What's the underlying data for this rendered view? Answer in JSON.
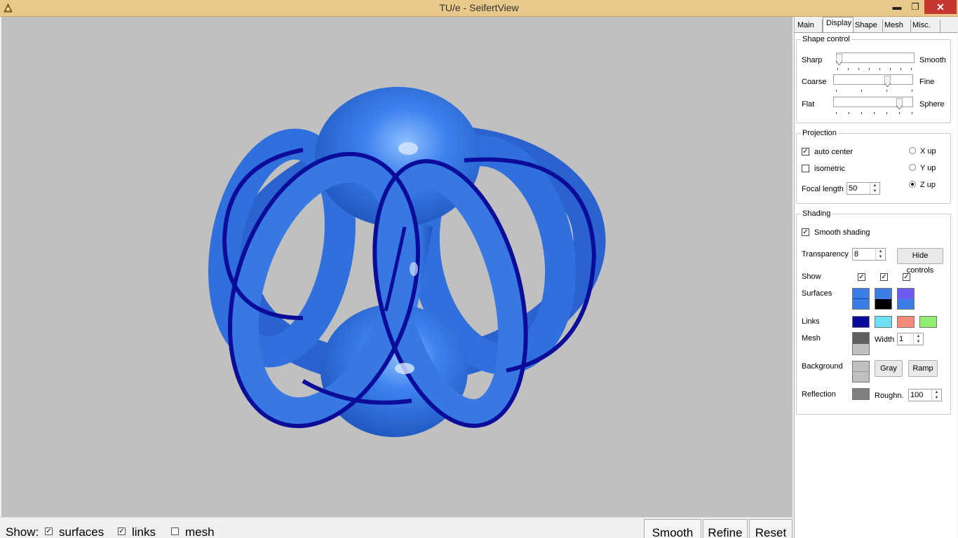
{
  "window": {
    "title": "TU/e - SeifertView",
    "close_glyph": "✕",
    "minimize_glyph": "▬",
    "maximize_glyph": "❐"
  },
  "colors": {
    "surface_blue": "#3c7ee8",
    "link_blue": "#0f0fa0",
    "background_gray": "#c0c0c0"
  },
  "bottom_bar": {
    "show_label": "Show:",
    "surfaces": {
      "label": "surfaces",
      "checked": true
    },
    "links": {
      "label": "links",
      "checked": true
    },
    "mesh": {
      "label": "mesh",
      "checked": false
    },
    "buttons": {
      "smooth": "Smooth",
      "refine": "Refine",
      "reset": "Reset"
    }
  },
  "tabs": [
    {
      "label": "Main",
      "active": false
    },
    {
      "label": "Display",
      "active": true
    },
    {
      "label": "Shape",
      "active": false
    },
    {
      "label": "Mesh",
      "active": false
    },
    {
      "label": "Misc.",
      "active": false
    }
  ],
  "shape_control": {
    "title": "Shape control",
    "sharp_smooth": {
      "left": "Sharp",
      "right": "Smooth",
      "value": 0.0
    },
    "coarse_fine": {
      "left": "Coarse",
      "right": "Fine",
      "value": 0.66
    },
    "flat_sphere": {
      "left": "Flat",
      "right": "Sphere",
      "value": 0.83
    }
  },
  "projection": {
    "title": "Projection",
    "auto_center": {
      "label": "auto center",
      "checked": true
    },
    "isometric": {
      "label": "isometric",
      "checked": false
    },
    "x_up": {
      "label": "X up",
      "selected": false
    },
    "y_up": {
      "label": "Y up",
      "selected": false
    },
    "z_up": {
      "label": "Z up",
      "selected": true
    },
    "focal_length_label": "Focal length",
    "focal_length": "50"
  },
  "shading": {
    "title": "Shading",
    "smooth_shading": {
      "label": "Smooth shading",
      "checked": true
    },
    "transparency_label": "Transparency",
    "transparency": "8",
    "hide_controls": "Hide controls",
    "show_label": "Show",
    "show_checks": [
      true,
      true,
      true
    ],
    "surfaces_label": "Surfaces",
    "surface_swatches": [
      [
        "#3a7de4",
        "#3a7de4"
      ],
      [
        "#3a7de4",
        "#000000"
      ],
      [
        "#6a5cf0",
        "#3a7de4"
      ]
    ],
    "links_label": "Links",
    "link_swatches": [
      "#0a0a9a",
      "#6ee0f5",
      "#f58a78",
      "#90ee70"
    ],
    "mesh_label": "Mesh",
    "mesh_swatch": [
      "#606060",
      "#c0c0c0"
    ],
    "width_label": "Width",
    "width": "1",
    "background_label": "Background",
    "background_swatch": [
      "#c0c0c0",
      "#c0c0c0"
    ],
    "gray_button": "Gray",
    "ramp_button": "Ramp",
    "reflection_label": "Reflection",
    "reflection_swatch": "#808080",
    "roughness_label": "Roughn.",
    "roughness": "100"
  }
}
